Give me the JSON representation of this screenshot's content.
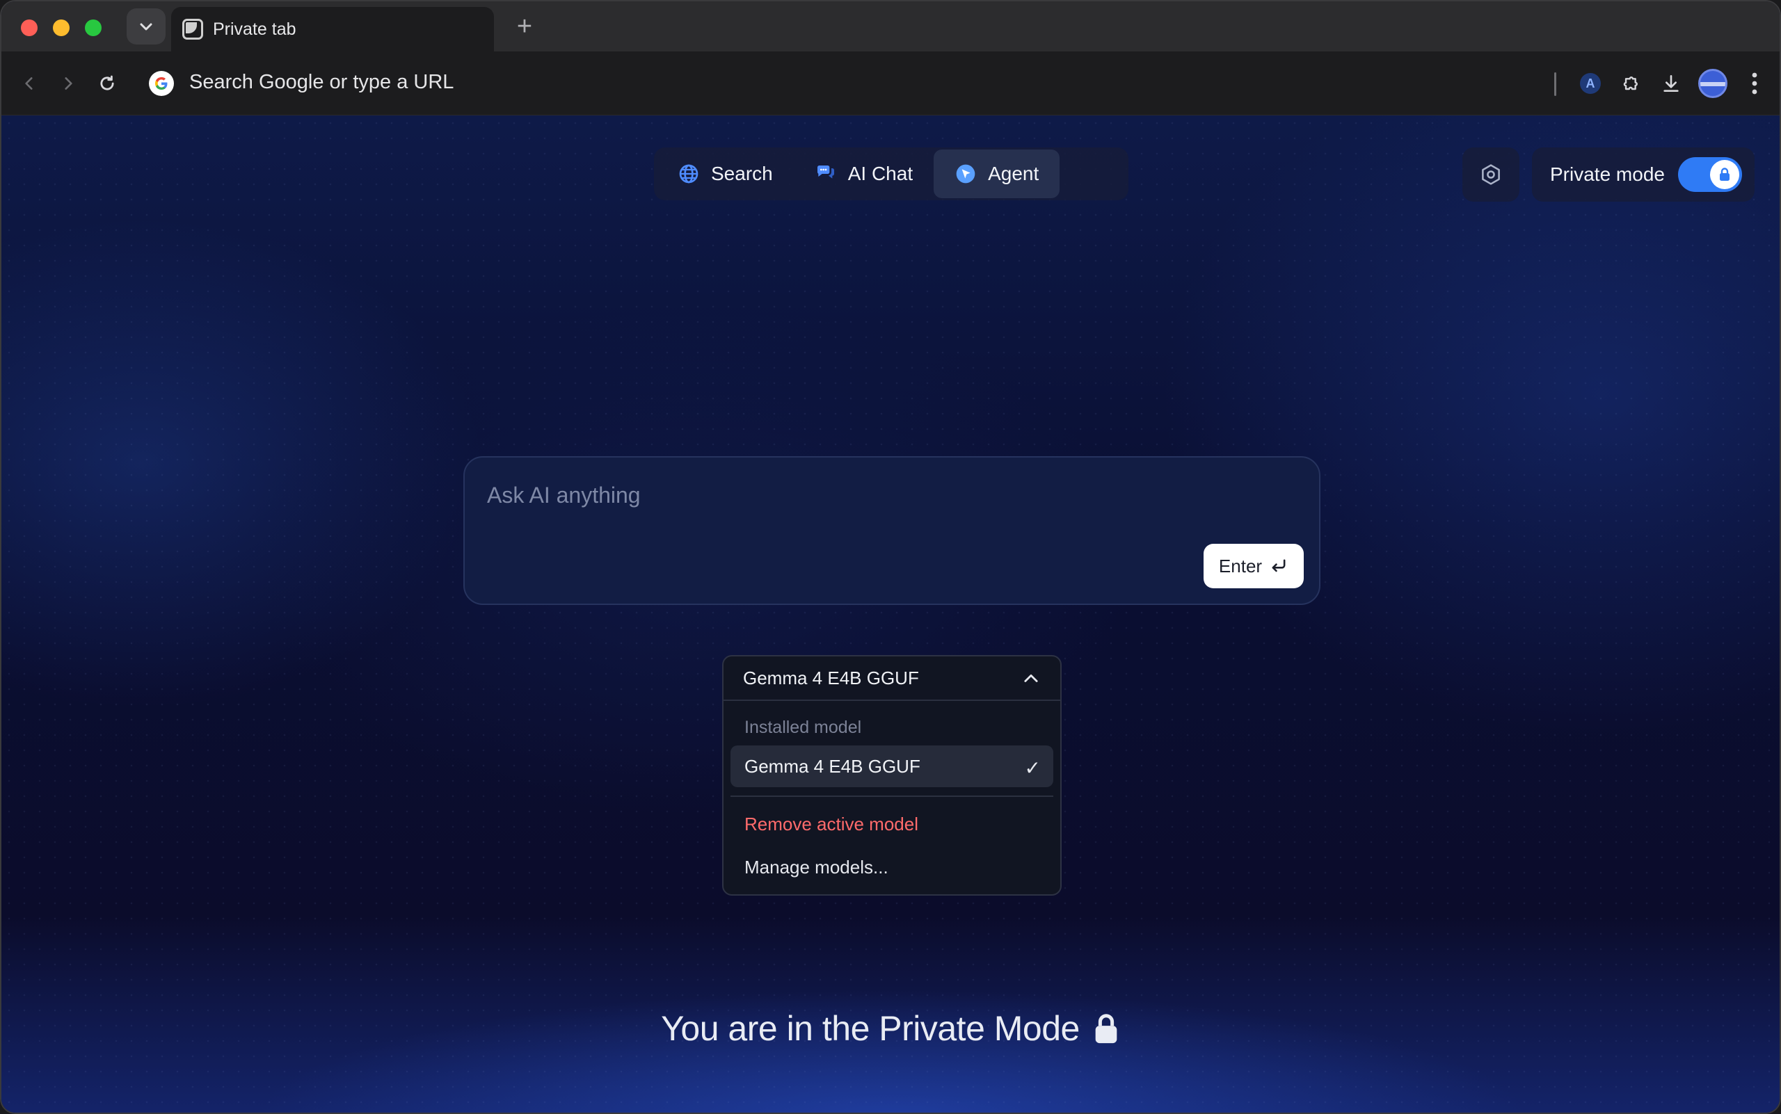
{
  "browser": {
    "tab": {
      "title": "Private tab"
    },
    "new_tab_symbol": "+",
    "omnibox": {
      "placeholder": "Search Google or type a URL"
    },
    "extension_badge": "A"
  },
  "modes": {
    "items": [
      {
        "label": "Search",
        "icon": "globe-icon"
      },
      {
        "label": "AI Chat",
        "icon": "chat-bubbles-icon"
      },
      {
        "label": "Agent",
        "icon": "agent-cursor-icon",
        "active": true
      }
    ]
  },
  "private_mode": {
    "label": "Private mode",
    "enabled": true
  },
  "ask": {
    "placeholder": "Ask AI anything",
    "enter_label": "Enter"
  },
  "model_picker": {
    "selected": "Gemma 4 E4B GGUF",
    "section_label": "Installed model",
    "items": [
      {
        "label": "Gemma 4 E4B GGUF",
        "checked": true
      }
    ],
    "check_mark": "✓",
    "remove_label": "Remove active model",
    "manage_label": "Manage models..."
  },
  "banner": {
    "text": "You are in the Private Mode"
  },
  "colors": {
    "accent": "#2f7bf5",
    "danger": "#ff6b6b",
    "background": "#0b0e2a"
  }
}
